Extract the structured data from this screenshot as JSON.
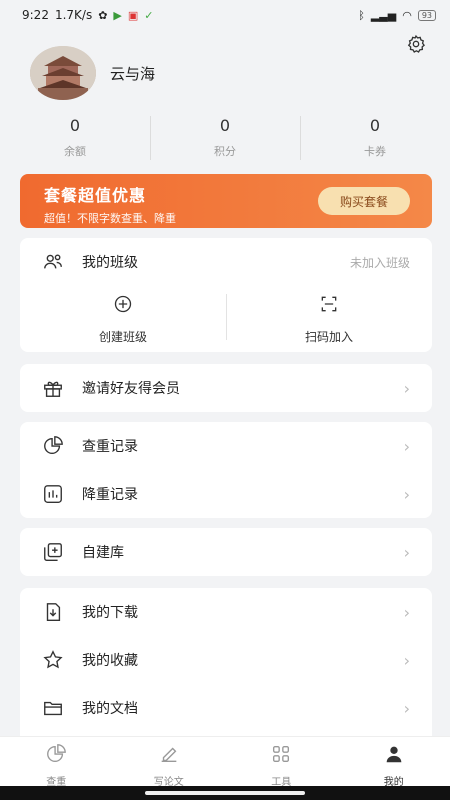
{
  "status_bar": {
    "time": "9:22",
    "speed": "1.7K/s",
    "battery": "93"
  },
  "profile": {
    "username": "云与海"
  },
  "stats": [
    {
      "value": "0",
      "label": "余额"
    },
    {
      "value": "0",
      "label": "积分"
    },
    {
      "value": "0",
      "label": "卡券"
    }
  ],
  "banner": {
    "title": "套餐超值优惠",
    "subtitle": "超值！不限字数查重、降重",
    "button": "购买套餐"
  },
  "my_class": {
    "title": "我的班级",
    "status": "未加入班级",
    "create": "创建班级",
    "scan_join": "扫码加入"
  },
  "menu": {
    "invite": "邀请好友得会员",
    "check_record": "查重记录",
    "reduce_record": "降重记录",
    "custom_lib": "自建库",
    "downloads": "我的下载",
    "favorites": "我的收藏",
    "documents": "我的文档"
  },
  "tabbar": [
    {
      "label": "查重"
    },
    {
      "label": "写论文"
    },
    {
      "label": "工具"
    },
    {
      "label": "我的"
    }
  ],
  "colors": {
    "accent": "#f06a2f",
    "banner_button_bg": "#f8e0b0"
  }
}
